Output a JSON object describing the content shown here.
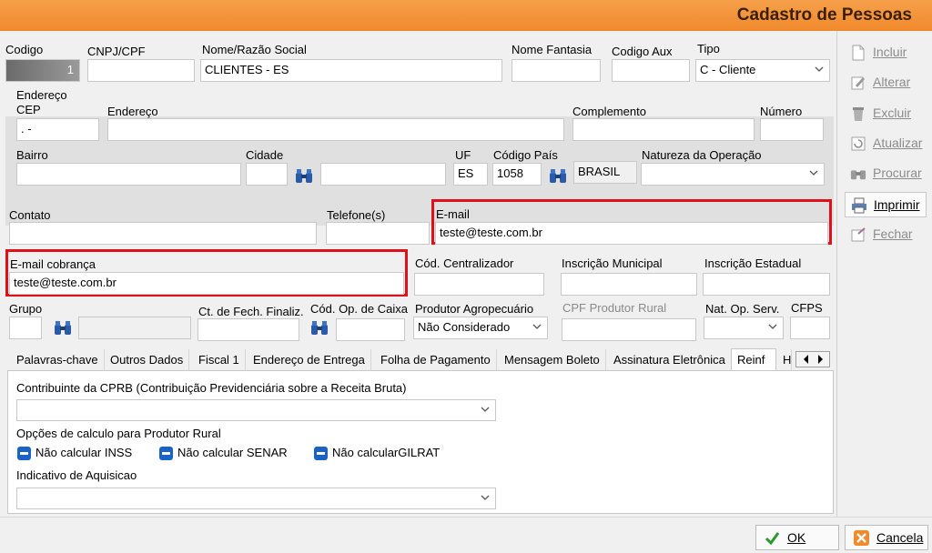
{
  "window": {
    "title": "Cadastro de Pessoas"
  },
  "row1": {
    "codigo_label": "Codigo",
    "codigo_value": "1",
    "cnpj_label": "CNPJ/CPF",
    "cnpj_value": "",
    "nome_label": "Nome/Razão Social",
    "nome_value": "CLIENTES - ES",
    "fantasia_label": "Nome Fantasia",
    "fantasia_value": "",
    "aux_label": "Codigo Aux",
    "aux_value": "",
    "tipo_label": "Tipo",
    "tipo_value": "C - Cliente"
  },
  "endereco": {
    "group_label": "Endereço",
    "cep_label": "CEP",
    "cep_value": "  .   -",
    "endereco_label": "Endereço",
    "endereco_value": "",
    "complemento_label": "Complemento",
    "complemento_value": "",
    "numero_label": "Número",
    "numero_value": "",
    "bairro_label": "Bairro",
    "bairro_value": "",
    "cidade_label": "Cidade",
    "cidade_code": "",
    "cidade_name": "",
    "uf_label": "UF",
    "uf_value": "ES",
    "pais_label": "Código País",
    "pais_code": "1058",
    "pais_name": "BRASIL",
    "natureza_label": "Natureza da Operação",
    "natureza_value": ""
  },
  "contato": {
    "contato_label": "Contato",
    "contato_value": "",
    "telefone_label": "Telefone(s)",
    "telefone_value": "",
    "email_label": "E-mail",
    "email_value": "teste@teste.com.br",
    "email_cobranca_label": "E-mail cobrança",
    "email_cobranca_value": "teste@teste.com.br",
    "centralizador_label": "Cód. Centralizador",
    "centralizador_value": "",
    "insc_mun_label": "Inscrição Municipal",
    "insc_mun_value": "",
    "insc_est_label": "Inscrição Estadual",
    "insc_est_value": ""
  },
  "row_grupo": {
    "grupo_label": "Grupo",
    "grupo_value": "",
    "grupo_desc": "",
    "ctfech_label": "Ct. de Fech. Finaliz.",
    "ctfech_value": "",
    "opcaixa_label": "Cód. Op. de Caixa",
    "opcaixa_value": "",
    "produtor_label": "Produtor Agropecuário",
    "produtor_value": "Não Considerado",
    "cpf_produtor_label": "CPF Produtor Rural",
    "cpf_produtor_value": "",
    "natop_label": "Nat. Op. Serv.",
    "natop_value": "",
    "cfps_label": "CFPS",
    "cfps_value": ""
  },
  "tabs": [
    "Palavras-chave",
    "Outros Dados",
    "Fiscal 1",
    "Endereço de Entrega",
    "Folha de Pagamento",
    "Mensagem Boleto",
    "Assinatura Eletrônica",
    "Reinf",
    "H"
  ],
  "reinf": {
    "cprb_label": "Contribuinte  da CPRB (Contribuição Previdenciária sobre a Receita Bruta)",
    "cprb_value": "",
    "opcoes_label": "Opções de calculo para Produtor Rural",
    "cb_inss": "Não calcular INSS",
    "cb_senar": "Não calcular SENAR",
    "cb_gilrat": "Não calcularGILRAT",
    "aquisicao_label": "Indicativo de Aquisicao",
    "aquisicao_value": ""
  },
  "side": {
    "incluir": "Incluir",
    "alterar": "Alterar",
    "excluir": "Excluir",
    "atualizar": "Atualizar",
    "procurar": "Procurar",
    "imprimir": "Imprimir",
    "fechar": "Fechar"
  },
  "bottom": {
    "ok": "OK",
    "cancela": "Cancela"
  },
  "colors": {
    "title_orange": "#f08a2c",
    "highlight_red": "#e0101a",
    "checkbox_blue": "#1a63c6"
  }
}
